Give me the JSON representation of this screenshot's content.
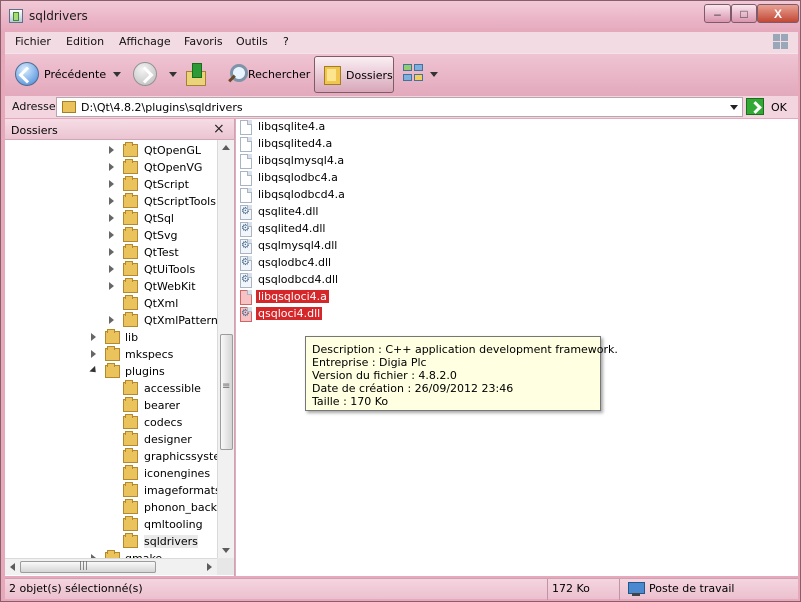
{
  "window": {
    "title": "sqldrivers",
    "minimize": "–",
    "maximize": "□",
    "close": "X"
  },
  "menu": [
    "Fichier",
    "Edition",
    "Affichage",
    "Favoris",
    "Outils",
    "?"
  ],
  "toolbar": {
    "back_label": "Précédente",
    "search_label": "Rechercher",
    "folders_label": "Dossiers"
  },
  "address": {
    "label": "Adresse",
    "value": "D:\\Qt\\4.8.2\\plugins\\sqldrivers",
    "go_label": "OK"
  },
  "folders_pane": {
    "title": "Dossiers",
    "close": "×",
    "items": [
      "QtOpenGL",
      "QtOpenVG",
      "QtScript",
      "QtScriptTools",
      "QtSql",
      "QtSvg",
      "QtTest",
      "QtUiTools",
      "QtWebKit",
      "QtXml",
      "QtXmlPatterns",
      "lib",
      "mkspecs",
      "plugins",
      "accessible",
      "bearer",
      "codecs",
      "designer",
      "graphicssysten",
      "iconengines",
      "imageformats",
      "phonon_backe",
      "qmltooling",
      "sqldrivers",
      "qmake"
    ]
  },
  "files": [
    "libqsqlite4.a",
    "libqsqlited4.a",
    "libqsqlmysql4.a",
    "libqsqlodbc4.a",
    "libqsqlodbcd4.a",
    "qsqlite4.dll",
    "qsqlited4.dll",
    "qsqlmysql4.dll",
    "qsqlodbc4.dll",
    "qsqlodbcd4.dll",
    "libqsqloci4.a",
    "qsqloci4.dll"
  ],
  "tooltip": {
    "description": "Description : C++ application development framework.",
    "company": "Entreprise : Digia Plc",
    "version": "Version du fichier : 4.8.2.0",
    "created": "Date de création : 26/09/2012 23:46",
    "size": "Taille  : 170 Ko"
  },
  "status": {
    "selection": "2 objet(s) sélectionné(s)",
    "size": "172 Ko",
    "location": "Poste de travail"
  }
}
